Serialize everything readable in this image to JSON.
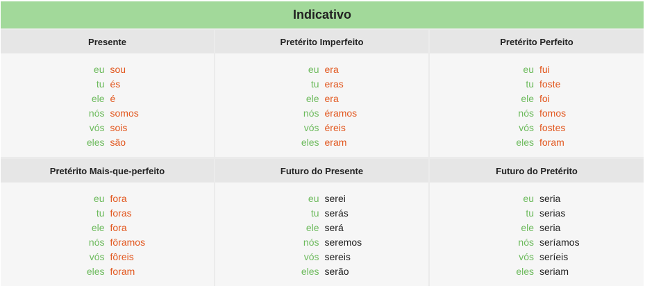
{
  "title": "Indicativo",
  "colors": {
    "title_bg": "#a2d99a",
    "pronoun": "#6cba5c",
    "irregular": "#e2571e",
    "regular": "#222222"
  },
  "tenses": [
    {
      "name": "Presente",
      "forms": [
        {
          "pronoun": "eu",
          "verb": "sou",
          "irregular": true
        },
        {
          "pronoun": "tu",
          "verb": "és",
          "irregular": true
        },
        {
          "pronoun": "ele",
          "verb": "é",
          "irregular": true
        },
        {
          "pronoun": "nós",
          "verb": "somos",
          "irregular": true
        },
        {
          "pronoun": "vós",
          "verb": "sois",
          "irregular": true
        },
        {
          "pronoun": "eles",
          "verb": "são",
          "irregular": true
        }
      ]
    },
    {
      "name": "Pretérito Imperfeito",
      "forms": [
        {
          "pronoun": "eu",
          "verb": "era",
          "irregular": true
        },
        {
          "pronoun": "tu",
          "verb": "eras",
          "irregular": true
        },
        {
          "pronoun": "ele",
          "verb": "era",
          "irregular": true
        },
        {
          "pronoun": "nós",
          "verb": "éramos",
          "irregular": true
        },
        {
          "pronoun": "vós",
          "verb": "éreis",
          "irregular": true
        },
        {
          "pronoun": "eles",
          "verb": "eram",
          "irregular": true
        }
      ]
    },
    {
      "name": "Pretérito Perfeito",
      "forms": [
        {
          "pronoun": "eu",
          "verb": "fui",
          "irregular": true
        },
        {
          "pronoun": "tu",
          "verb": "foste",
          "irregular": true
        },
        {
          "pronoun": "ele",
          "verb": "foi",
          "irregular": true
        },
        {
          "pronoun": "nós",
          "verb": "fomos",
          "irregular": true
        },
        {
          "pronoun": "vós",
          "verb": "fostes",
          "irregular": true
        },
        {
          "pronoun": "eles",
          "verb": "foram",
          "irregular": true
        }
      ]
    },
    {
      "name": "Pretérito Mais-que-perfeito",
      "forms": [
        {
          "pronoun": "eu",
          "verb": "fora",
          "irregular": true
        },
        {
          "pronoun": "tu",
          "verb": "foras",
          "irregular": true
        },
        {
          "pronoun": "ele",
          "verb": "fora",
          "irregular": true
        },
        {
          "pronoun": "nós",
          "verb": "fôramos",
          "irregular": true
        },
        {
          "pronoun": "vós",
          "verb": "fôreis",
          "irregular": true
        },
        {
          "pronoun": "eles",
          "verb": "foram",
          "irregular": true
        }
      ]
    },
    {
      "name": "Futuro do Presente",
      "forms": [
        {
          "pronoun": "eu",
          "verb": "serei",
          "irregular": false
        },
        {
          "pronoun": "tu",
          "verb": "serás",
          "irregular": false
        },
        {
          "pronoun": "ele",
          "verb": "será",
          "irregular": false
        },
        {
          "pronoun": "nós",
          "verb": "seremos",
          "irregular": false
        },
        {
          "pronoun": "vós",
          "verb": "sereis",
          "irregular": false
        },
        {
          "pronoun": "eles",
          "verb": "serão",
          "irregular": false
        }
      ]
    },
    {
      "name": "Futuro do Pretérito",
      "forms": [
        {
          "pronoun": "eu",
          "verb": "seria",
          "irregular": false
        },
        {
          "pronoun": "tu",
          "verb": "serias",
          "irregular": false
        },
        {
          "pronoun": "ele",
          "verb": "seria",
          "irregular": false
        },
        {
          "pronoun": "nós",
          "verb": "seríamos",
          "irregular": false
        },
        {
          "pronoun": "vós",
          "verb": "seríeis",
          "irregular": false
        },
        {
          "pronoun": "eles",
          "verb": "seriam",
          "irregular": false
        }
      ]
    }
  ]
}
